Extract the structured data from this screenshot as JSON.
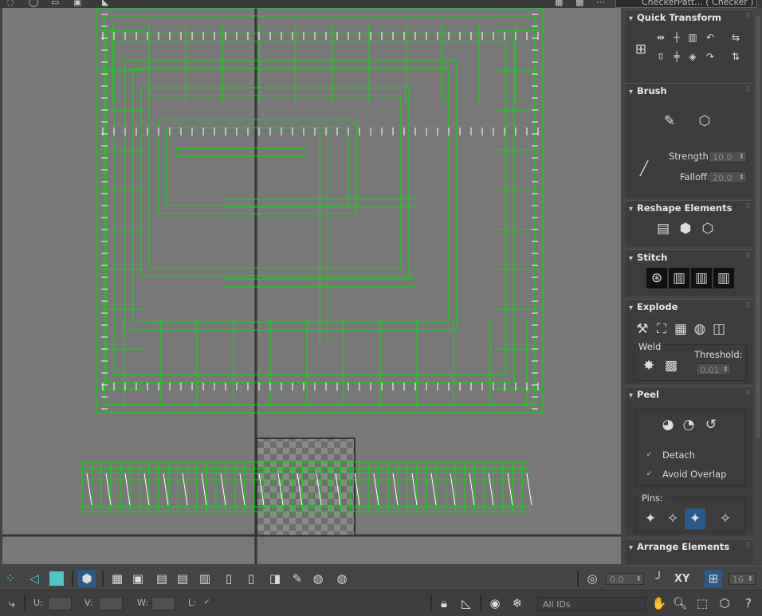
{
  "top_bar": {
    "checker_dropdown": "CheckerPatt... ( Checker )"
  },
  "uv_editor": {
    "checker_map": "checker-pattern"
  },
  "panels": {
    "quick_transform": {
      "title": "Quick Transform"
    },
    "brush": {
      "title": "Brush",
      "strength_label": "Strength:",
      "strength_value": "10.0",
      "falloff_label": "Falloff:",
      "falloff_value": "20.0"
    },
    "reshape_elements": {
      "title": "Reshape Elements"
    },
    "stitch": {
      "title": "Stitch"
    },
    "explode": {
      "title": "Explode",
      "weld_label": "Weld",
      "threshold_label": "Threshold:",
      "threshold_value": "0.01"
    },
    "peel": {
      "title": "Peel",
      "detach_label": "Detach",
      "avoid_overlap_label": "Avoid Overlap",
      "pins_label": "Pins:"
    },
    "arrange_elements": {
      "title": "Arrange Elements"
    }
  },
  "bottom_toolbar": {
    "rotation_value": "0.0",
    "xy_label": "XY",
    "grid_value": "16"
  },
  "status_bar": {
    "u_label": "U:",
    "v_label": "V:",
    "w_label": "W:",
    "l_label": "L:",
    "ids_dropdown": "All IDs"
  },
  "colors": {
    "wire_green": "#00e000",
    "viewport_gray": "#787878",
    "panel_bg": "#444444"
  }
}
